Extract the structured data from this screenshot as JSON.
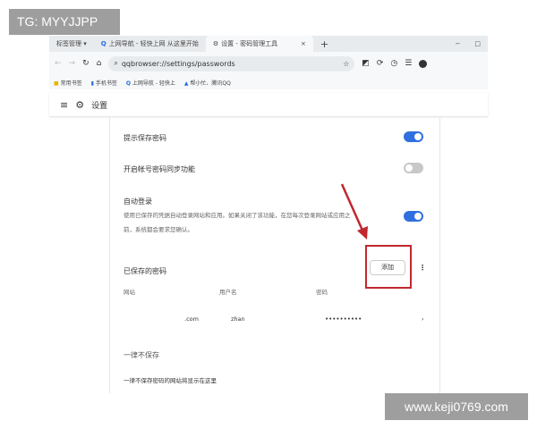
{
  "overlay": {
    "tg_label": "TG: MYYJJPP",
    "watermark": "www.keji0769.com"
  },
  "tabs": [
    {
      "label": "标签管理 ▾"
    },
    {
      "label": "上网导航 - 轻快上网 从这里开始"
    },
    {
      "label": "设置 - 密码管理工具",
      "active": true
    }
  ],
  "tab_close": "×",
  "new_tab": "+",
  "window_min": "−",
  "window_max": "□",
  "address": {
    "url": "qqbrowser://settings/passwords"
  },
  "bookmarks": [
    "常用书签",
    "手机书签",
    "上网导航 - 轻快上",
    "帮小忙、腾讯QQ"
  ],
  "header": {
    "title": "设置"
  },
  "settings": {
    "offer_save": {
      "label": "提示保存密码",
      "enabled": true
    },
    "sync": {
      "label": "开启帐号密码同步功能",
      "enabled": false
    },
    "auto_login": {
      "label": "自动登录",
      "desc1": "使用已保存的凭据自动登录网站和应用。如果关闭了该功能，在您每次登录网站或应用之",
      "desc2": "前，系统都会要求您确认。",
      "enabled": true
    }
  },
  "saved": {
    "title": "已保存的密码",
    "add_label": "添加",
    "columns": [
      "网站",
      "用户名",
      "密码"
    ],
    "rows": [
      {
        "site": ".com",
        "user": "zhan",
        "password": "••••••••••"
      }
    ]
  },
  "never": {
    "title": "一律不保存",
    "desc": "一律不保存密码的网站将显示在这里"
  },
  "colors": {
    "accent": "#2f6fe0",
    "annotation": "#c0282e"
  }
}
